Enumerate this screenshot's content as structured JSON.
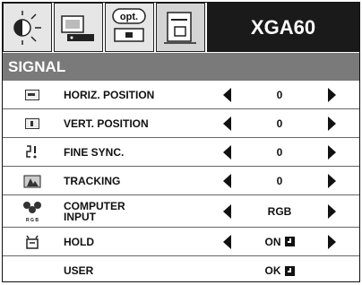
{
  "tabs": [
    {
      "name": "picture-adjust-tab",
      "icon": "brightness-icon"
    },
    {
      "name": "image-tab",
      "icon": "screen-icon"
    },
    {
      "name": "option-tab",
      "icon": "opt-icon",
      "text": "opt."
    },
    {
      "name": "signal-tab",
      "icon": "signal-icon",
      "active": true
    }
  ],
  "header": {
    "mode": "XGA60"
  },
  "section": {
    "title": "SIGNAL"
  },
  "rows": [
    {
      "label": "HORIZ. POSITION",
      "value": "0",
      "icon": "horiz-position-icon"
    },
    {
      "label": "VERT. POSITION",
      "value": "0",
      "icon": "vert-position-icon"
    },
    {
      "label": "FINE SYNC.",
      "value": "0",
      "icon": "fine-sync-icon"
    },
    {
      "label": "TRACKING",
      "value": "0",
      "icon": "tracking-icon"
    },
    {
      "label": "COMPUTER\nINPUT",
      "value": "RGB",
      "icon": "rgb-icon",
      "icon_text": "R G B"
    },
    {
      "label": "HOLD",
      "value": "ON",
      "icon": "hold-icon"
    },
    {
      "label": "USER",
      "value": "OK",
      "icon": "none"
    }
  ]
}
